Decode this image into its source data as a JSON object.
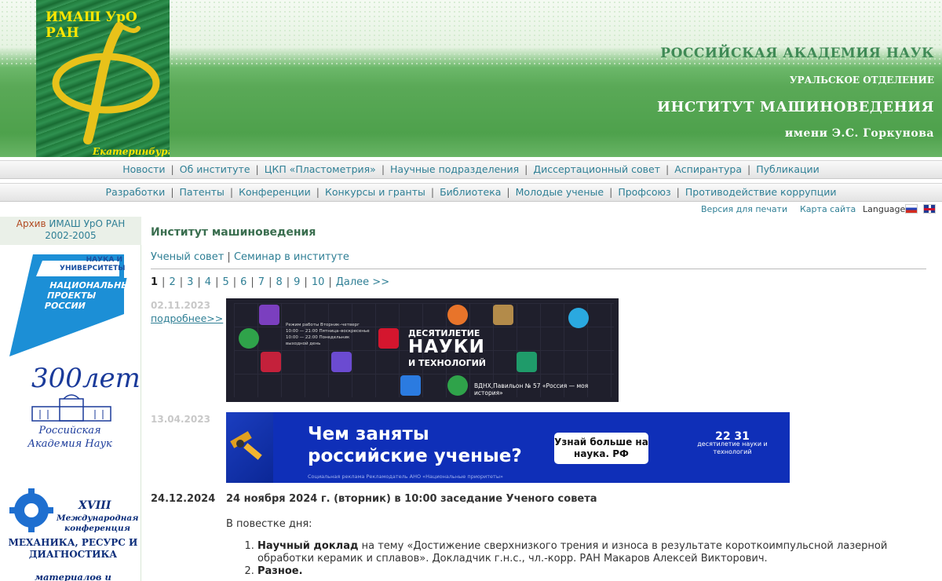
{
  "header": {
    "logo_title": "ИМАШ УрО РАН",
    "logo_city": "Екатеринбург",
    "academy": "РОССИЙСКАЯ АКАДЕМИЯ НАУК",
    "branch": "УРАЛЬСКОЕ ОТДЕЛЕНИЕ",
    "institute": "ИНСТИТУТ МАШИНОВЕДЕНИЯ",
    "named": "имени Э.С. Горкунова"
  },
  "nav1": [
    "Новости",
    "Об институте",
    "ЦКП «Пластометрия»",
    "Научные подразделения",
    "Диссертационный совет",
    "Аспирантура",
    "Публикации"
  ],
  "nav2": [
    "Разработки",
    "Патенты",
    "Конференции",
    "Конкурсы и гранты",
    "Библиотека",
    "Молодые ученые",
    "Профсоюз",
    "Противодействие коррупции"
  ],
  "utility": {
    "print": "Версия для печати",
    "map": "Карта сайта",
    "language": "Language"
  },
  "sidebar": {
    "archive_prefix": "Архив",
    "archive_link": "ИМАШ УрО РАН",
    "archive_years": "2002-2005",
    "np_small": "НАУКА И УНИВЕРСИТЕТЫ",
    "np_big": "НАЦИОНАЛЬНЫЕ ПРОЕКТЫ РОССИИ",
    "rac_300": "300лет",
    "rac_name": "Российская Академия Наук",
    "conf_num": "XVIII",
    "conf_intl": "Международная конференция",
    "conf_topic": "МЕХАНИКА, РЕСУРС И ДИАГНОСТИКА",
    "conf_sub": "материалов и конструкций"
  },
  "main": {
    "title": "Институт машиноведения",
    "subnav": [
      "Ученый совет",
      "Семинар в институте"
    ],
    "pager": {
      "current": "1",
      "pages": [
        "2",
        "3",
        "4",
        "5",
        "6",
        "7",
        "8",
        "9",
        "10"
      ],
      "next": "Далее >>"
    },
    "item1": {
      "date": "02.11.2023",
      "more": "подробнее>>",
      "banner_line1": "ДЕСЯТИЛЕТИЕ",
      "banner_big": "НАУКИ",
      "banner_sub": "И ТЕХНОЛОГИЙ",
      "banner_foot": "ВДНХ,Павильон № 57 «Россия — моя история»",
      "banner_sched": "Режим работы Вторник–четверг 10:00 — 21:00 Пятница–воскресенье 10:00 — 22:00 Понедельник выходной день"
    },
    "item2": {
      "date": "13.04.2023",
      "question": "Чем заняты российские ученые?",
      "button": "Узнай больше на наука. РФ",
      "note": "Социальная реклама     Рекламодатель АНО «Национальные приоритеты»",
      "logo_num": "22 31",
      "logo_text": "десятилетие науки и технологий"
    },
    "news": {
      "date": "24.12.2024",
      "title": "24 ноября 2024 г. (вторник) в 10:00 заседание Ученого совета",
      "agenda_label": "В повестке дня:",
      "items": [
        {
          "bold": "Научный доклад",
          "text": " на тему «Достижение сверхнизкого трения и износа в результате короткоимпульсной лазерной обработки керамик и сплавов». Докладчик г.н.с., чл.-корр. РАН Макаров Алексей Викторович."
        },
        {
          "bold": "Разное.",
          "text": ""
        }
      ]
    }
  }
}
